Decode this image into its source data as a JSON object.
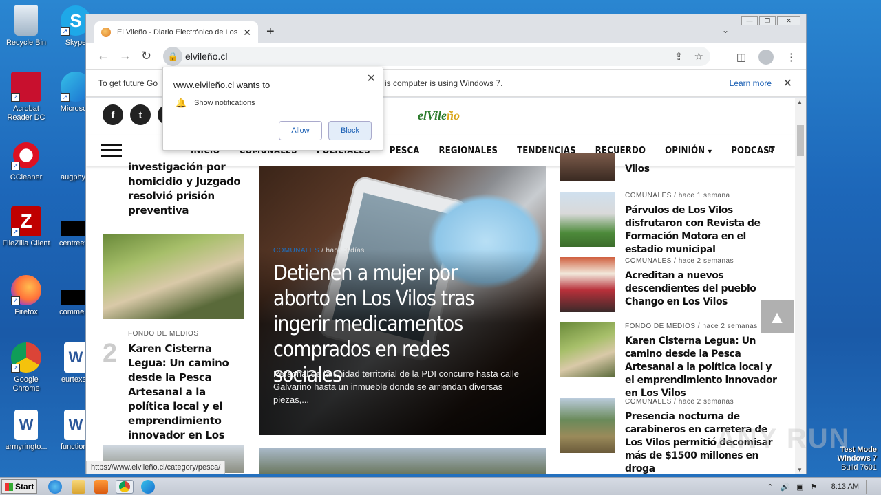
{
  "desktop": {
    "icons": [
      {
        "label": "Recycle Bin"
      },
      {
        "label": "Skype"
      },
      {
        "label": "Acrobat Reader DC"
      },
      {
        "label": "Microsoft"
      },
      {
        "label": "CCleaner"
      },
      {
        "label": "augphysi"
      },
      {
        "label": "FileZilla Client"
      },
      {
        "label": "centreeve"
      },
      {
        "label": "Firefox"
      },
      {
        "label": "commentl"
      },
      {
        "label": "Google Chrome"
      },
      {
        "label": "eurtexas"
      },
      {
        "label": "armyringto..."
      },
      {
        "label": "functions"
      }
    ]
  },
  "browser": {
    "tab_title": "El Vileño - Diario Electrónico de Los V",
    "url": "elvileño.cl",
    "infobar_text": "To get future Go",
    "infobar_text_2": "is computer is using Windows 7.",
    "infobar_link": "Learn more",
    "status_url": "https://www.elvileño.cl/category/pesca/"
  },
  "popup": {
    "title": "www.elvileño.cl wants to",
    "permission": "Show notifications",
    "allow": "Allow",
    "block": "Block"
  },
  "site": {
    "logo_main": "elVile",
    "logo_accent": "ño",
    "nav": [
      "INICIO",
      "COMUNALES",
      "POLICIALES",
      "PESCA",
      "REGIONALES",
      "TENDENCIAS",
      "RECUERDO",
      "OPINIÓN",
      "PODCAST"
    ],
    "left": {
      "item1_title": "investigación por homicidio y Juzgado resolvió prisión preventiva",
      "item2_num": "2",
      "item2_cat": "FONDO DE MEDIOS",
      "item2_title": "Karen Cisterna Legua: Un camino desde la Pesca Artesanal a la política local y el emprendimiento innovador en Los Vilos"
    },
    "hero": {
      "cat": "COMUNALES",
      "sep": "/",
      "time": "hace 3 días",
      "title": "Detienen a mujer por aborto en Los Vilos tras ingerir medicamentos comprados en redes sociales",
      "summary": "Personal de la unidad territorial de la PDI concurre hasta calle Galvarino hasta un inmueble donde se arriendan diversas piezas,..."
    },
    "right": [
      {
        "cat": "",
        "time": "",
        "title": "Vilos"
      },
      {
        "cat": "COMUNALES",
        "time": "hace 1 semana",
        "title": "Párvulos de Los Vilos disfrutaron con Revista de Formación Motora en el estadio municipal"
      },
      {
        "cat": "COMUNALES",
        "time": "hace 2 semanas",
        "title": "Acreditan a nuevos descendientes del pueblo Chango en Los Vilos"
      },
      {
        "cat": "FONDO DE MEDIOS",
        "time": "hace 2 semanas",
        "title": "Karen Cisterna Legua: Un camino desde la Pesca Artesanal a la política local y el emprendimiento innovador en Los Vilos"
      },
      {
        "cat": "COMUNALES",
        "time": "hace 2 semanas",
        "title": "Presencia nocturna de carabineros en carretera de Los Vilos permitió decomisar más de $1500 millones en droga"
      }
    ]
  },
  "taskbar": {
    "start": "Start",
    "clock": "8:13 AM"
  },
  "watermark": {
    "line1": "Test Mode",
    "line2": "Windows 7",
    "line3": "Build 7601",
    "anyrun": "ANY RUN"
  }
}
